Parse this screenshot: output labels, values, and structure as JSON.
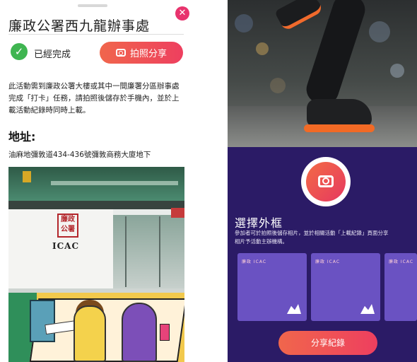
{
  "left_panel": {
    "title": "廉政公署西九龍辦事處",
    "close_glyph": "✕",
    "status_label": "已經完成",
    "status_icon": "checkmark-icon",
    "share_button_label": "拍照分享",
    "description": "此活動需到廉政公署大樓或其中一間廉署分區辦事處完成「打卡」任務，請拍照後儲存於手機內，並於上載活動紀錄時同時上載。",
    "address_heading": "地址:",
    "address": "油麻地彌敦道434-436號彌敦商務大廈地下",
    "photo": {
      "seal_text": "廉政公署",
      "logo_text": "ICAC"
    }
  },
  "right_panel": {
    "frame_title": "選擇外框",
    "frame_description_line1": "參加者可於拍照後儲存相片，並於相關活動「上載紀錄」頁面分享",
    "frame_description_line2": "相片予活動主辦機構。",
    "frame_cards": [
      {
        "logo_text": "廉政 ICAC"
      },
      {
        "logo_text": "廉政 ICAC"
      },
      {
        "logo_text": "廉政 ICAC"
      }
    ],
    "share_record_label": "分享紀錄"
  },
  "colors": {
    "accent": "#ee3f5f",
    "success": "#3fb551",
    "purple_bg": "#2b1b66",
    "card_bg": "#6a52c2"
  }
}
